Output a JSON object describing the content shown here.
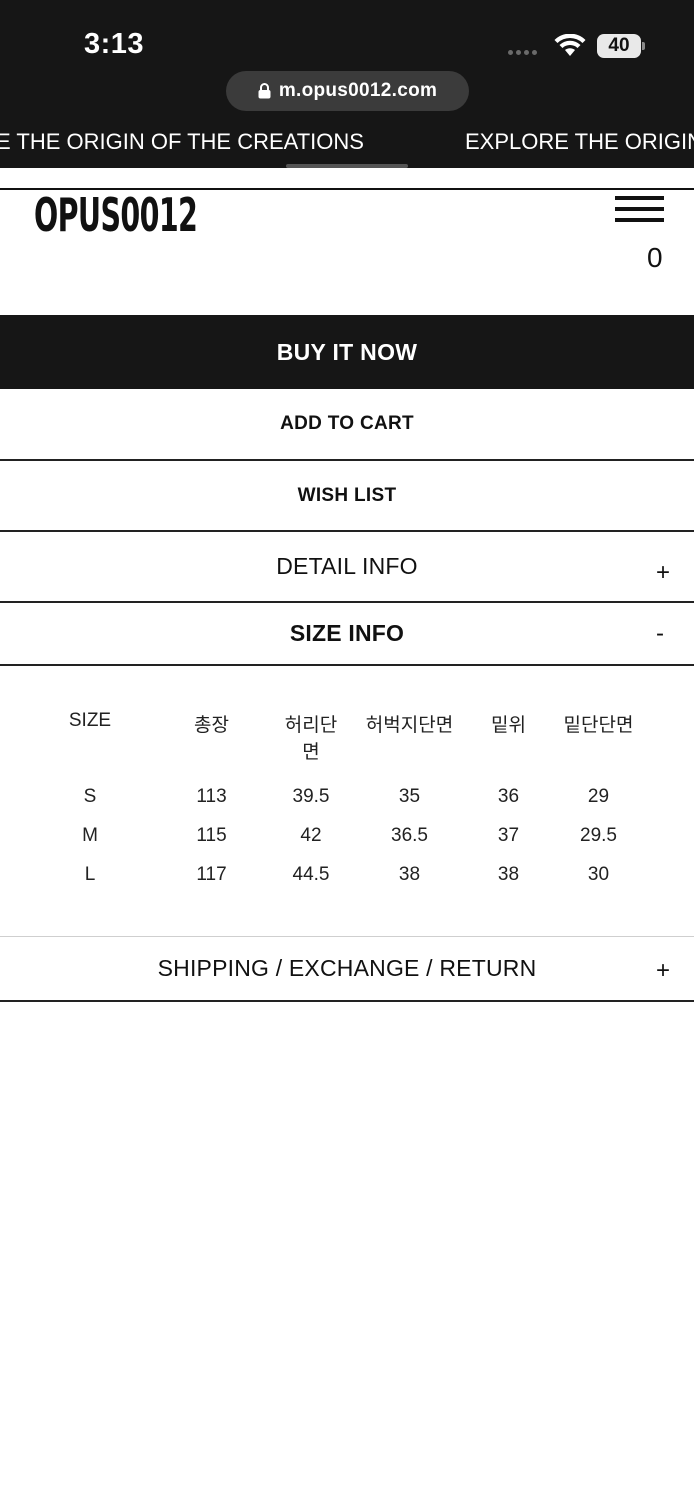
{
  "status_bar": {
    "time": "3:13",
    "battery": "40"
  },
  "browser": {
    "url": "m.opus0012.com"
  },
  "marquee": {
    "text1": "E THE ORIGIN OF THE CREATIONS",
    "text2": "EXPLORE THE ORIGIN"
  },
  "header": {
    "logo": "OPUS0012",
    "cart_count": "0"
  },
  "buttons": {
    "buy_now": "BUY IT NOW",
    "add_to_cart": "ADD TO CART",
    "wish_list": "WISH LIST"
  },
  "accordions": [
    {
      "label": "DETAIL INFO",
      "sign": "+"
    },
    {
      "label": "SIZE INFO",
      "sign": "-"
    },
    {
      "label": "SHIPPING / EXCHANGE / RETURN",
      "sign": "+"
    }
  ],
  "size_table": {
    "headers": [
      "SIZE",
      "총장",
      "허리단면",
      "허벅지단면",
      "밑위",
      "밑단단면"
    ],
    "rows": [
      [
        "S",
        "113",
        "39.5",
        "35",
        "36",
        "29"
      ],
      [
        "M",
        "115",
        "42",
        "36.5",
        "37",
        "29.5"
      ],
      [
        "L",
        "117",
        "44.5",
        "38",
        "38",
        "30"
      ]
    ]
  }
}
